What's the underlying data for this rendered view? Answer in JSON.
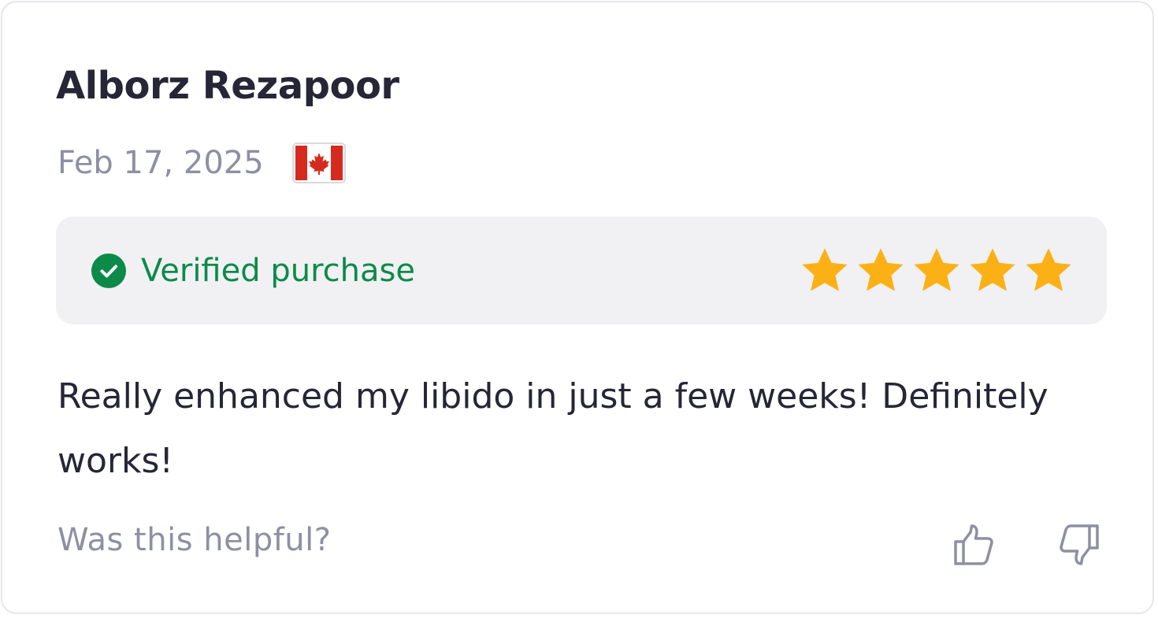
{
  "review": {
    "reviewer_name": "Alborz Rezapoor",
    "date": "Feb 17, 2025",
    "country_flag_icon": "canada-flag-icon",
    "verified": {
      "label": "Verified purchase",
      "icon": "check-circle-icon",
      "color": "#0c8a4a"
    },
    "rating": {
      "value": 5,
      "max": 5,
      "star_color": "#fbb116"
    },
    "body": "Really enhanced my libido in just a few weeks! Definitely works!"
  },
  "feedback": {
    "prompt": "Was this helpful?",
    "up_icon": "thumbs-up-icon",
    "down_icon": "thumbs-down-icon"
  }
}
